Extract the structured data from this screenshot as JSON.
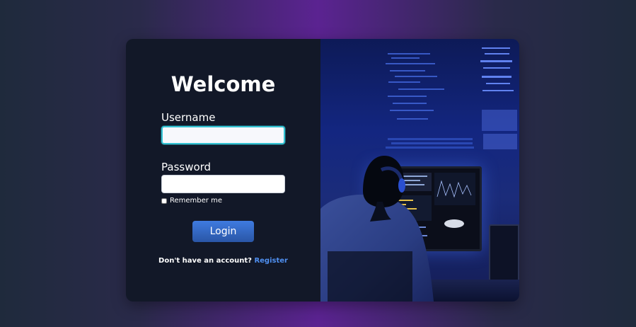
{
  "form": {
    "title": "Welcome",
    "username_label": "Username",
    "username_value": "",
    "password_label": "Password",
    "password_value": "",
    "remember_label": "Remember me",
    "login_label": "Login",
    "register_prompt": "Don't have an account?",
    "register_link": "Register"
  },
  "colors": {
    "accent": "#3f7be0",
    "panel": "#121828",
    "focus_border": "#34c3d3",
    "link": "#4f8ff0"
  },
  "icons": {
    "checkbox": "checkbox-icon"
  }
}
